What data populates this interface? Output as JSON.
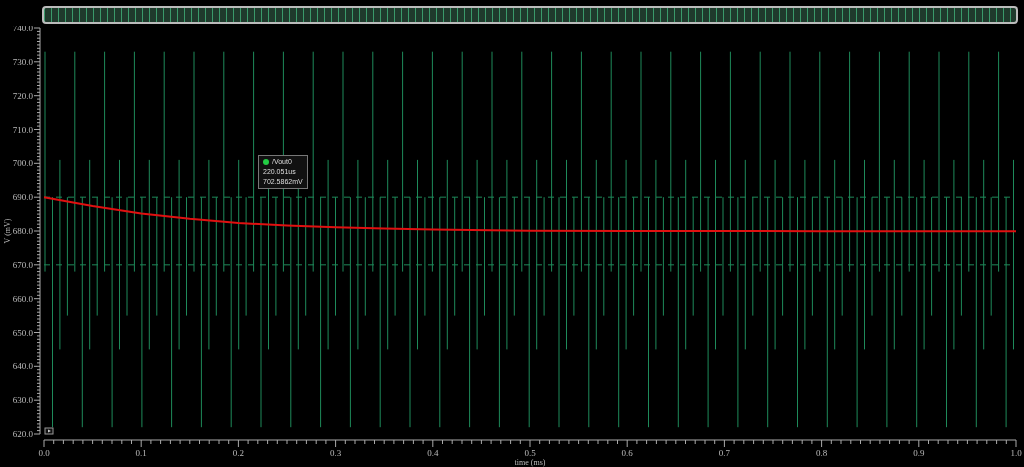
{
  "plot": {
    "chart_data": {
      "type": "line",
      "xlabel": "time (ms)",
      "ylabel": "V (mV)",
      "xlim": [
        0,
        1
      ],
      "ylim": [
        620,
        740
      ],
      "xticks": [
        {
          "value": 0,
          "label": "0.0"
        },
        {
          "value": 0.1,
          "label": "0.1"
        },
        {
          "value": 0.2,
          "label": "0.2"
        },
        {
          "value": 0.3,
          "label": "0.3"
        },
        {
          "value": 0.4,
          "label": "0.4"
        },
        {
          "value": 0.5,
          "label": "0.5"
        },
        {
          "value": 0.6,
          "label": "0.6"
        },
        {
          "value": 0.7,
          "label": "0.7"
        },
        {
          "value": 0.8,
          "label": "0.8"
        },
        {
          "value": 0.9,
          "label": "0.9"
        },
        {
          "value": 1,
          "label": "1.0"
        }
      ],
      "yticks": [
        {
          "value": 620,
          "label": "620.0"
        },
        {
          "value": 630,
          "label": "630.0"
        },
        {
          "value": 640,
          "label": "640.0"
        },
        {
          "value": 650,
          "label": "650.0"
        },
        {
          "value": 660,
          "label": "660.0"
        },
        {
          "value": 670,
          "label": "670.0"
        },
        {
          "value": 680,
          "label": "680.0"
        },
        {
          "value": 690,
          "label": "690.0"
        },
        {
          "value": 700,
          "label": "700.0"
        },
        {
          "value": 710,
          "label": "710.0"
        },
        {
          "value": 720,
          "label": "720.0"
        },
        {
          "value": 730,
          "label": "730.0"
        },
        {
          "value": 740,
          "label": "740.0"
        }
      ],
      "x": [
        0,
        0.05,
        0.1,
        0.15,
        0.2,
        0.25,
        0.3,
        0.35,
        0.4,
        0.5,
        0.6,
        0.7,
        0.8,
        0.9,
        1.0
      ],
      "series": [
        {
          "name": "/Vout0",
          "color": "#e01010",
          "values": [
            690,
            687.4,
            685.2,
            683.6,
            682.4,
            681.6,
            681.1,
            680.7,
            680.4,
            680.1,
            680.0,
            680.0,
            679.9,
            679.9,
            679.9
          ]
        }
      ]
    },
    "marker": {
      "color": "#22cc44",
      "time": "220.051us",
      "value": "702.5862mV"
    }
  }
}
